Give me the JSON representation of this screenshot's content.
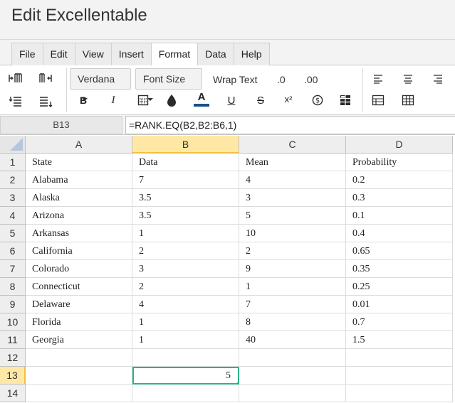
{
  "app": {
    "title": "Edit Excellentable"
  },
  "menu": {
    "tabs": [
      {
        "label": "File"
      },
      {
        "label": "Edit"
      },
      {
        "label": "View"
      },
      {
        "label": "Insert"
      },
      {
        "label": "Format",
        "active": true
      },
      {
        "label": "Data"
      },
      {
        "label": "Help"
      }
    ]
  },
  "toolbar": {
    "font_family": "Verdana",
    "font_size": "Font Size",
    "wrap_text": "Wrap Text",
    "decrease_decimals": ".0",
    "increase_decimals": ".00",
    "bold": "B",
    "italic": "I",
    "font_color": "A",
    "underline": "U",
    "strikethrough": "S",
    "superscript": "x²",
    "accent_color": "#1a4f8a"
  },
  "formula_bar": {
    "cell_ref": "B13",
    "formula": "=RANK.EQ(B2,B2:B6,1)"
  },
  "sheet": {
    "columns": [
      "A",
      "B",
      "C",
      "D"
    ],
    "rows": [
      "1",
      "2",
      "3",
      "4",
      "5",
      "6",
      "7",
      "8",
      "9",
      "10",
      "11",
      "12",
      "13",
      "14"
    ],
    "selected_column": "B",
    "selected_row": "13",
    "cells": [
      [
        "State",
        "Data",
        "Mean",
        "Probability"
      ],
      [
        "Alabama",
        "7",
        "4",
        "0.2"
      ],
      [
        "Alaska",
        "3.5",
        "3",
        "0.3"
      ],
      [
        "Arizona",
        "3.5",
        "5",
        "0.1"
      ],
      [
        "Arkansas",
        "1",
        "10",
        "0.4"
      ],
      [
        "California",
        "2",
        "2",
        "0.65"
      ],
      [
        "Colorado",
        "3",
        "9",
        "0.35"
      ],
      [
        "Connecticut",
        "2",
        "1",
        "0.25"
      ],
      [
        "Delaware",
        "4",
        "7",
        "0.01"
      ],
      [
        "Florida",
        "1",
        "8",
        "0.7"
      ],
      [
        "Georgia",
        "1",
        "40",
        "1.5"
      ],
      [
        "",
        "",
        "",
        ""
      ],
      [
        "",
        "5",
        "",
        ""
      ],
      [
        "",
        "",
        "",
        ""
      ]
    ],
    "active_cell_color": "#2db28a",
    "selection_header_color": "#ffe8a6"
  }
}
